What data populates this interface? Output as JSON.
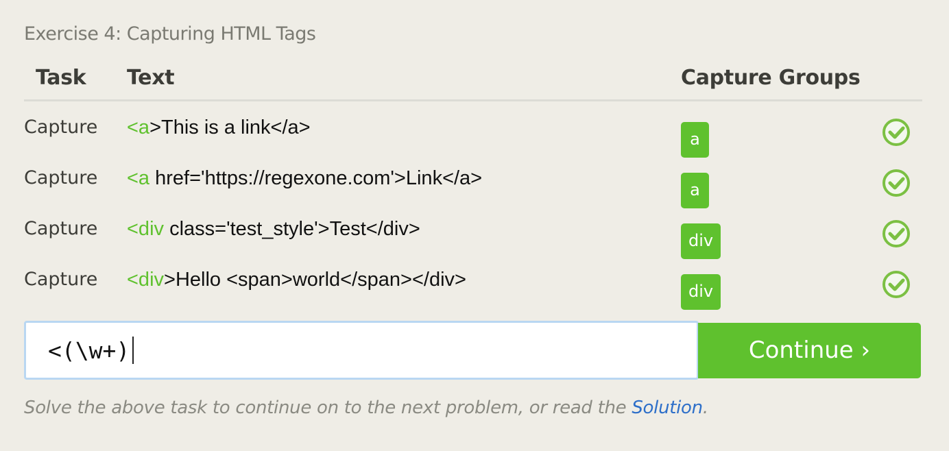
{
  "exercise": {
    "title": "Exercise 4: Capturing HTML Tags"
  },
  "table": {
    "headers": {
      "task": "Task",
      "text": "Text",
      "groups": "Capture Groups"
    },
    "rows": [
      {
        "task": "Capture",
        "text_highlight": "<a",
        "text_rest": ">This is a link</a>",
        "group": "a",
        "status": "check-icon"
      },
      {
        "task": "Capture",
        "text_highlight": "<a",
        "text_rest": " href='https://regexone.com'>Link</a>",
        "group": "a",
        "status": "check-icon"
      },
      {
        "task": "Capture",
        "text_highlight": "<div",
        "text_rest": " class='test_style'>Test</div>",
        "group": "div",
        "status": "check-icon"
      },
      {
        "task": "Capture",
        "text_highlight": "<div",
        "text_rest": ">Hello <span>world</span></div>",
        "group": "div",
        "status": "check-icon"
      }
    ]
  },
  "input": {
    "value": "<(\\w+)"
  },
  "continue_button": {
    "label": "Continue ›"
  },
  "footer": {
    "text": "Solve the above task to continue on to the next problem, or read the ",
    "link": "Solution",
    "end": "."
  },
  "colors": {
    "background": "#efede6",
    "accent_green": "#5fc12e",
    "link_blue": "#2d6fc9",
    "input_border": "#b9d7f2"
  }
}
